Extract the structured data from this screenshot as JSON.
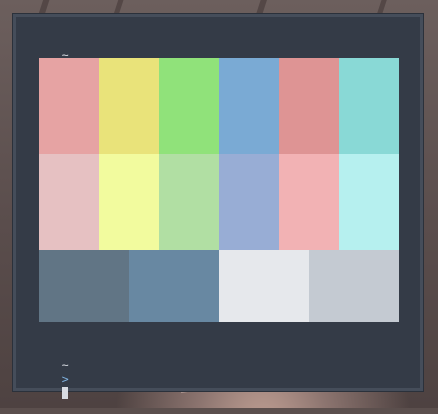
{
  "terminal": {
    "first_prompt": {
      "tilde": "~",
      "arrow": ">",
      "command": "colorblock"
    },
    "second_prompt": {
      "tilde": "~",
      "arrow": ">"
    }
  },
  "colorblock": {
    "rows": [
      [
        "#e6a3a3",
        "#e9e37a",
        "#90e27a",
        "#7aaad4",
        "#de9494",
        "#89d9d6"
      ],
      [
        "#e6c1c2",
        "#f2fb9e",
        "#b1dfa3",
        "#98add5",
        "#f2b2b4",
        "#b6f0ef"
      ],
      [
        "#617585",
        "#6888a2",
        "#e6e8ec",
        "#c4cad2"
      ]
    ]
  },
  "colors": {
    "terminal_bg": "#343b47",
    "prompt_arrow": "#7fb2e0",
    "text": "#c9ced8"
  }
}
